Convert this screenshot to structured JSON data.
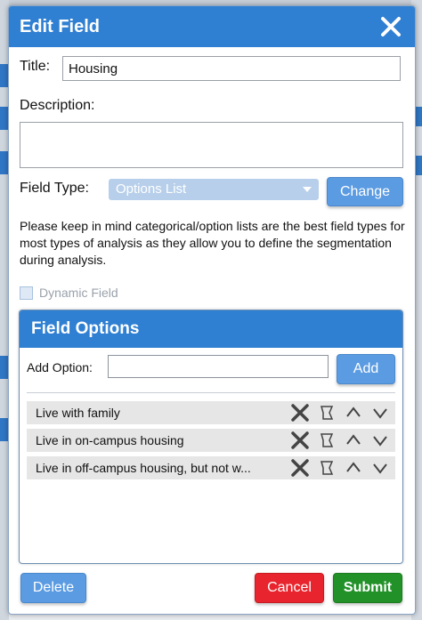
{
  "modal": {
    "title": "Edit Field",
    "title_label": "Title:",
    "title_value": "Housing",
    "description_label": "Description:",
    "description_value": "",
    "field_type_label": "Field Type:",
    "field_type_value": "Options List",
    "change_label": "Change",
    "note": "Please keep in mind categorical/option lists are the best field types for most types of analysis as they allow you to define the segmentation during analysis.",
    "dynamic_field_label": "Dynamic Field",
    "dynamic_field_checked": false
  },
  "options": {
    "header": "Field Options",
    "add_option_label": "Add Option:",
    "add_option_value": "",
    "add_button_label": "Add",
    "items": [
      {
        "label": "Live with family"
      },
      {
        "label": "Live in on-campus housing"
      },
      {
        "label": "Live in off-campus housing, but not w..."
      }
    ],
    "icons": [
      "close-icon",
      "tag-icon",
      "chevron-up-icon",
      "chevron-down-icon"
    ]
  },
  "footer": {
    "delete_label": "Delete",
    "cancel_label": "Cancel",
    "submit_label": "Submit"
  },
  "colors": {
    "header_blue": "#2f7fd2",
    "button_blue": "#5a9be2",
    "cancel_red": "#e8252e",
    "submit_green": "#229128"
  }
}
